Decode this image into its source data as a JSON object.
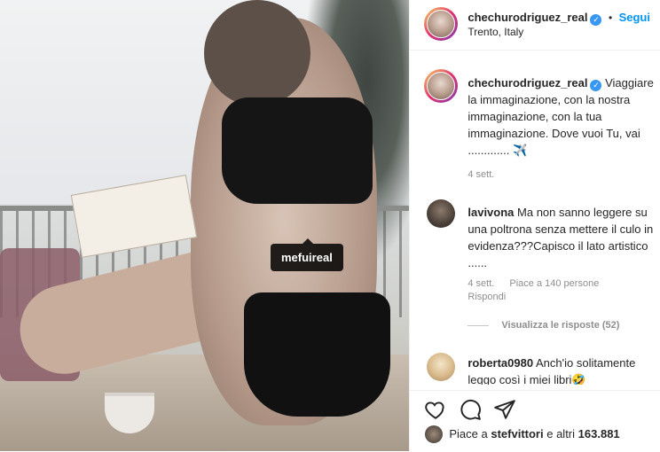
{
  "post": {
    "tag_label": "mefuireal"
  },
  "header": {
    "username": "chechurodriguez_real",
    "separator": "•",
    "follow_label": "Segui",
    "location": "Trento, Italy"
  },
  "caption": {
    "username": "chechurodriguez_real",
    "text": "Viaggiare la immaginazione, con la nostra immaginazione, con la tua immaginazione. Dove vuoi Tu, vai ............. ✈️",
    "time": "4 sett."
  },
  "comments": [
    {
      "username": "lavivona",
      "text": "Ma non sanno leggere su una poltrona senza mettere il culo in evidenza???Capisco il lato artistico ......",
      "time": "4 sett.",
      "likes": "Piace a 140 persone",
      "reply_label": "Rispondi",
      "view_replies": "Visualizza le risposte (52)"
    },
    {
      "username": "roberta0980",
      "text": "Anch'io solitamente leggo così i miei libri🤣"
    }
  ],
  "likes_summary": {
    "prefix": "Piace a",
    "user": "stefvittori",
    "connector": "e altri",
    "count": "163.881"
  },
  "icons": {
    "like": "heart-icon",
    "comment": "comment-icon",
    "share": "paper-plane-icon"
  },
  "colors": {
    "link": "#0095f6",
    "verified": "#3897f0",
    "muted": "#8e8e8e"
  }
}
